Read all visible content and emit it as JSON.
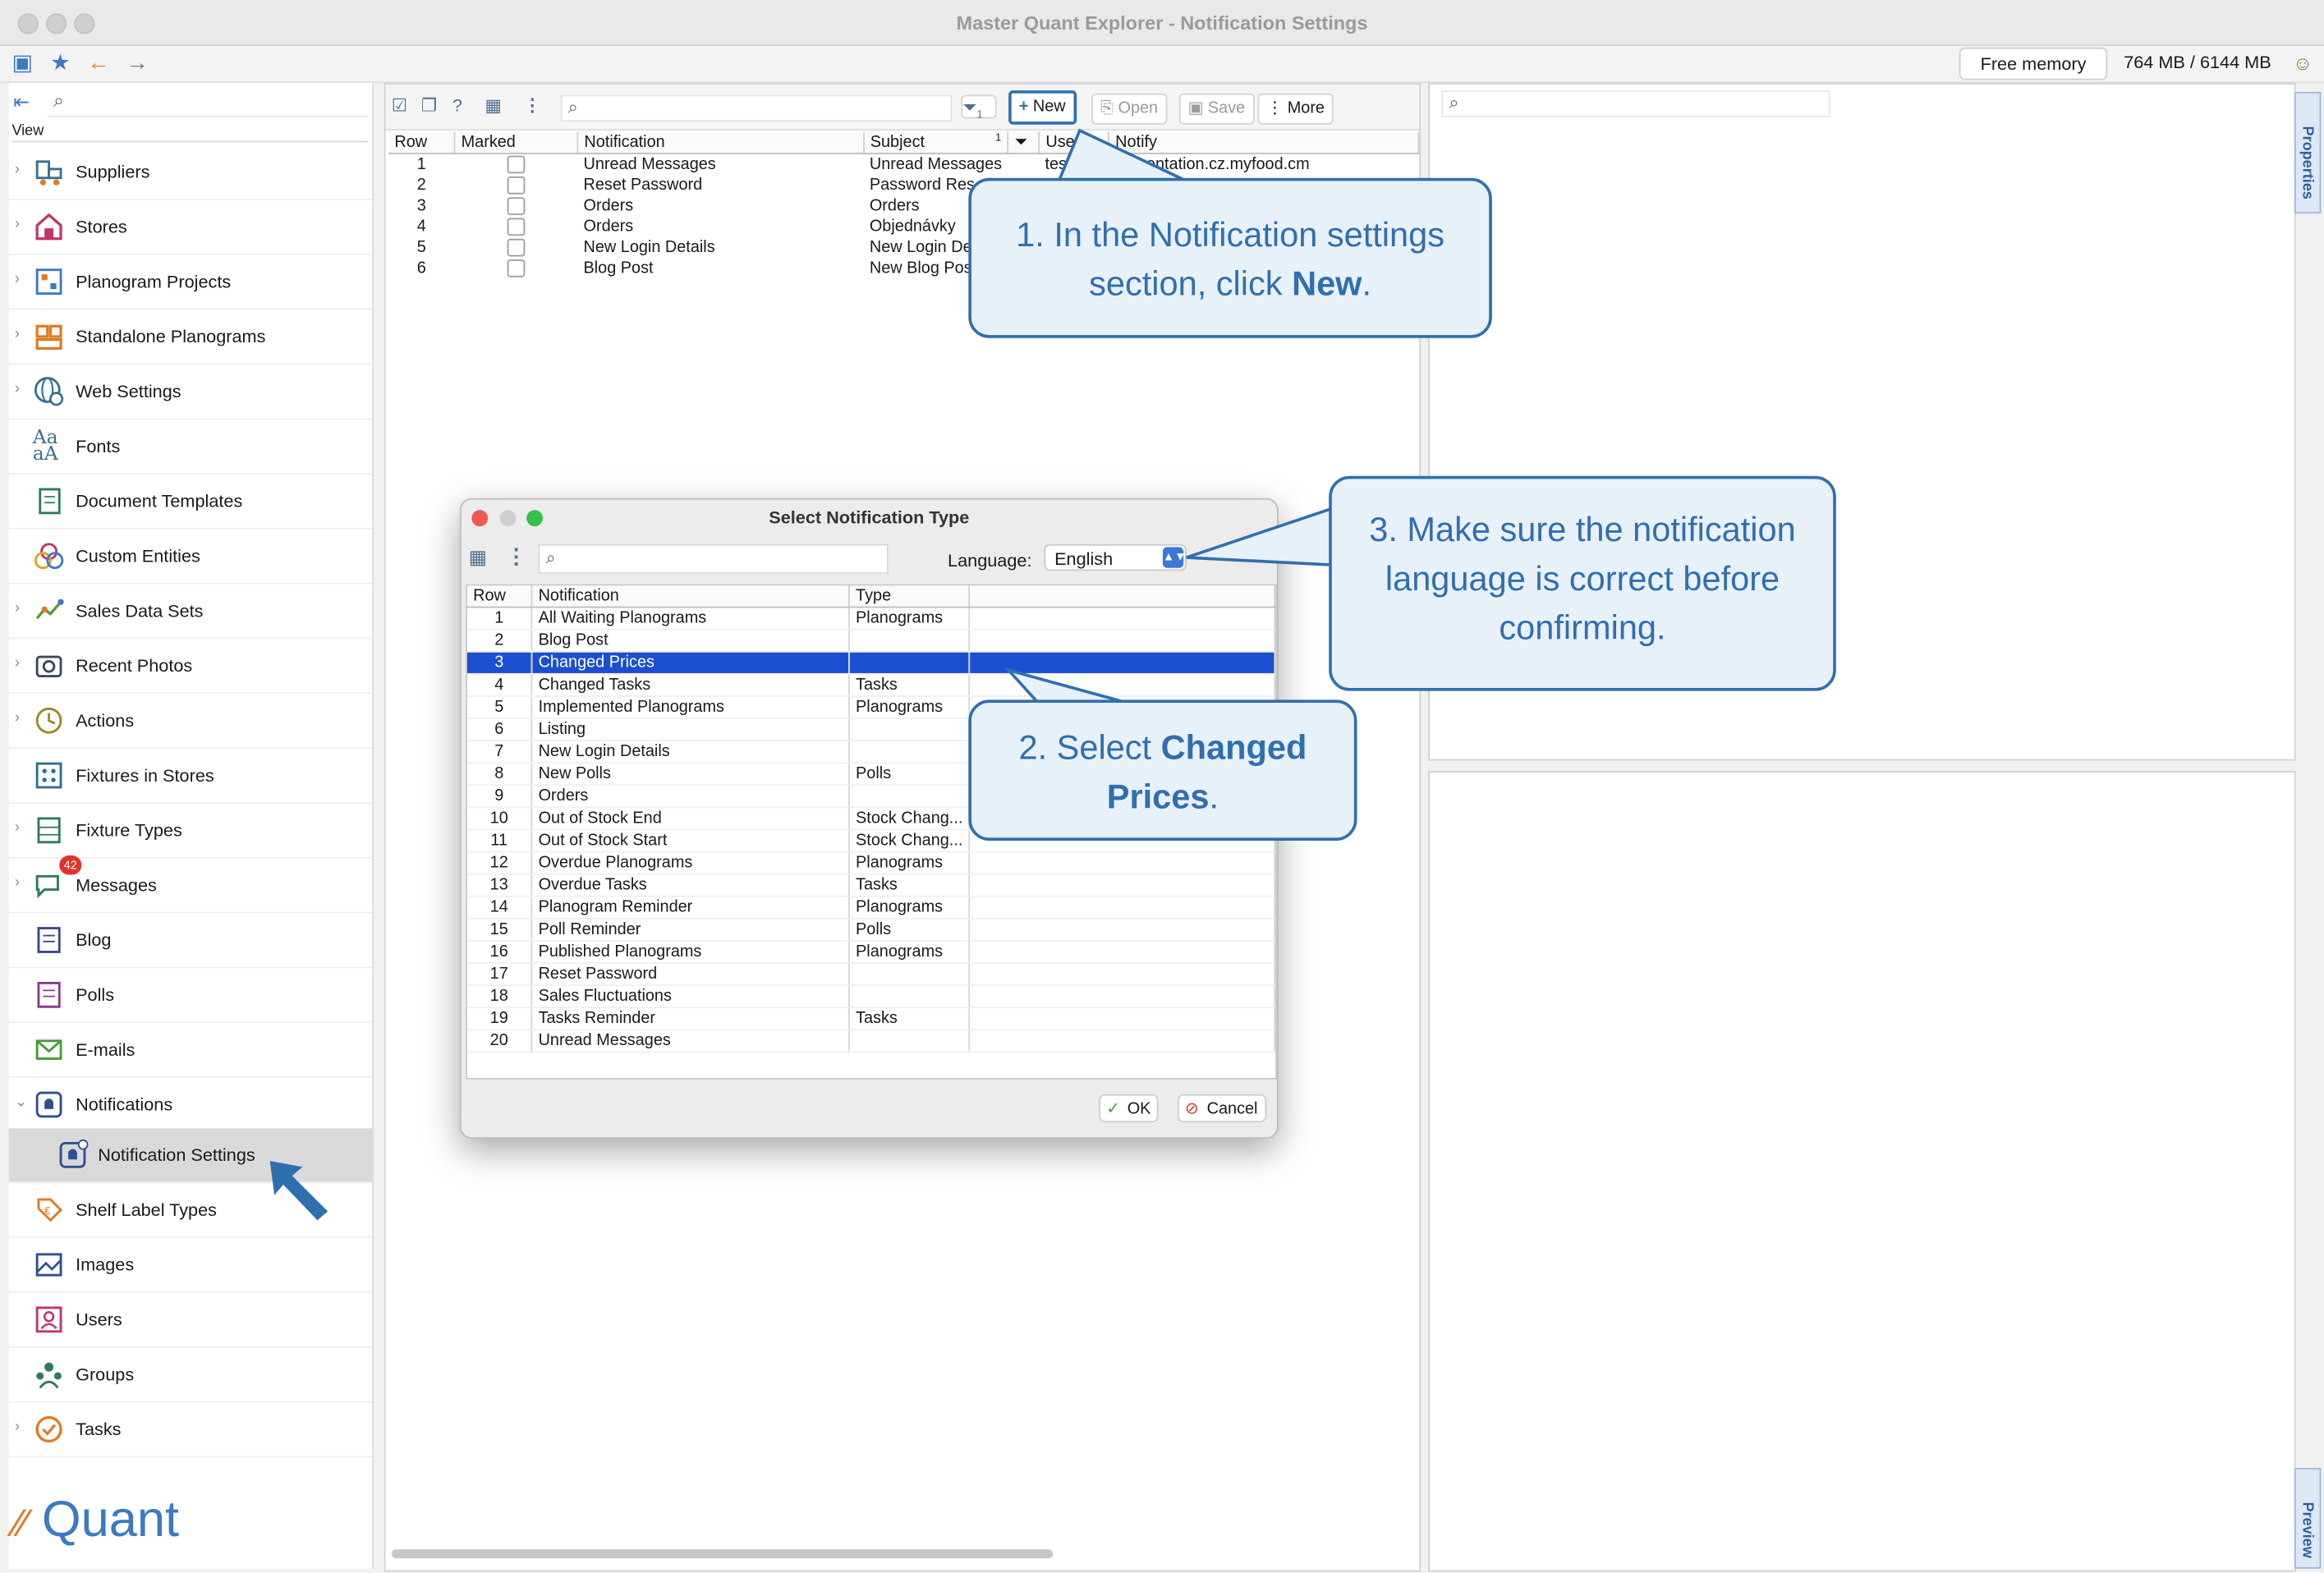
{
  "app": {
    "title": "Master Quant Explorer - Notification Settings"
  },
  "memory": {
    "button": "Free memory",
    "value": "764 MB / 6144 MB"
  },
  "sidebar": {
    "view_label": "View",
    "items": [
      {
        "label": "Suppliers"
      },
      {
        "label": "Stores"
      },
      {
        "label": "Planogram Projects"
      },
      {
        "label": "Standalone Planograms"
      },
      {
        "label": "Web Settings"
      },
      {
        "label": "Fonts"
      },
      {
        "label": "Document Templates"
      },
      {
        "label": "Custom Entities"
      },
      {
        "label": "Sales Data Sets"
      },
      {
        "label": "Recent Photos"
      },
      {
        "label": "Actions"
      },
      {
        "label": "Fixtures in Stores"
      },
      {
        "label": "Fixture Types"
      },
      {
        "label": "Messages",
        "badge": "42"
      },
      {
        "label": "Blog"
      },
      {
        "label": "Polls"
      },
      {
        "label": "E-mails"
      },
      {
        "label": "Notifications"
      },
      {
        "label": "Notification Settings"
      },
      {
        "label": "Shelf Label Types"
      },
      {
        "label": "Images"
      },
      {
        "label": "Users"
      },
      {
        "label": "Groups"
      },
      {
        "label": "Tasks"
      }
    ],
    "logo": "Quant"
  },
  "center": {
    "toolbar": {
      "filter_count": "1",
      "new": "New",
      "open": "Open",
      "save": "Save",
      "more": "More"
    },
    "columns": [
      "Row",
      "Marked",
      "Notification",
      "Subject",
      "1",
      "User",
      "Notify"
    ],
    "rows": [
      {
        "row": "1",
        "notification": "Unread Messages",
        "subject": "Unread Messages",
        "user": "test",
        "notify": "presentation.cz.myfood.cm"
      },
      {
        "row": "2",
        "notification": "Reset Password",
        "subject": "Password Res",
        "user": "",
        "notify": ""
      },
      {
        "row": "3",
        "notification": "Orders",
        "subject": "Orders",
        "user": "",
        "notify": ""
      },
      {
        "row": "4",
        "notification": "Orders",
        "subject": "Objednávky",
        "user": "",
        "notify": ""
      },
      {
        "row": "5",
        "notification": "New Login Details",
        "subject": "New Login De",
        "user": "",
        "notify": ""
      },
      {
        "row": "6",
        "notification": "Blog Post",
        "subject": "New Blog Pos",
        "user": "",
        "notify": ""
      }
    ]
  },
  "right": {
    "properties_tab": "Properties",
    "preview_tab": "Preview"
  },
  "dialog": {
    "title": "Select Notification Type",
    "language_label": "Language:",
    "language_value": "English",
    "columns": [
      "Row",
      "Notification",
      "Type"
    ],
    "rows": [
      {
        "row": "1",
        "notification": "All Waiting Planograms",
        "type": "Planograms"
      },
      {
        "row": "2",
        "notification": "Blog Post",
        "type": ""
      },
      {
        "row": "3",
        "notification": "Changed Prices",
        "type": ""
      },
      {
        "row": "4",
        "notification": "Changed Tasks",
        "type": "Tasks"
      },
      {
        "row": "5",
        "notification": "Implemented Planograms",
        "type": "Planograms"
      },
      {
        "row": "6",
        "notification": "Listing",
        "type": ""
      },
      {
        "row": "7",
        "notification": "New Login Details",
        "type": ""
      },
      {
        "row": "8",
        "notification": "New Polls",
        "type": "Polls"
      },
      {
        "row": "9",
        "notification": "Orders",
        "type": ""
      },
      {
        "row": "10",
        "notification": "Out of Stock End",
        "type": "Stock Chang..."
      },
      {
        "row": "11",
        "notification": "Out of Stock Start",
        "type": "Stock Chang..."
      },
      {
        "row": "12",
        "notification": "Overdue Planograms",
        "type": "Planograms"
      },
      {
        "row": "13",
        "notification": "Overdue Tasks",
        "type": "Tasks"
      },
      {
        "row": "14",
        "notification": "Planogram Reminder",
        "type": "Planograms"
      },
      {
        "row": "15",
        "notification": "Poll Reminder",
        "type": "Polls"
      },
      {
        "row": "16",
        "notification": "Published Planograms",
        "type": "Planograms"
      },
      {
        "row": "17",
        "notification": "Reset Password",
        "type": ""
      },
      {
        "row": "18",
        "notification": "Sales Fluctuations",
        "type": ""
      },
      {
        "row": "19",
        "notification": "Tasks Reminder",
        "type": "Tasks"
      },
      {
        "row": "20",
        "notification": "Unread Messages",
        "type": ""
      }
    ],
    "selected_row": "3",
    "ok": "OK",
    "cancel": "Cancel"
  },
  "callouts": {
    "c1": {
      "pre": "1. In the Notification settings section, click ",
      "bold": "New",
      "post": "."
    },
    "c2": {
      "pre": "2. Select ",
      "bold": "Changed Prices",
      "post": "."
    },
    "c3": {
      "text": "3. Make sure the notification language is correct before confirming."
    }
  }
}
